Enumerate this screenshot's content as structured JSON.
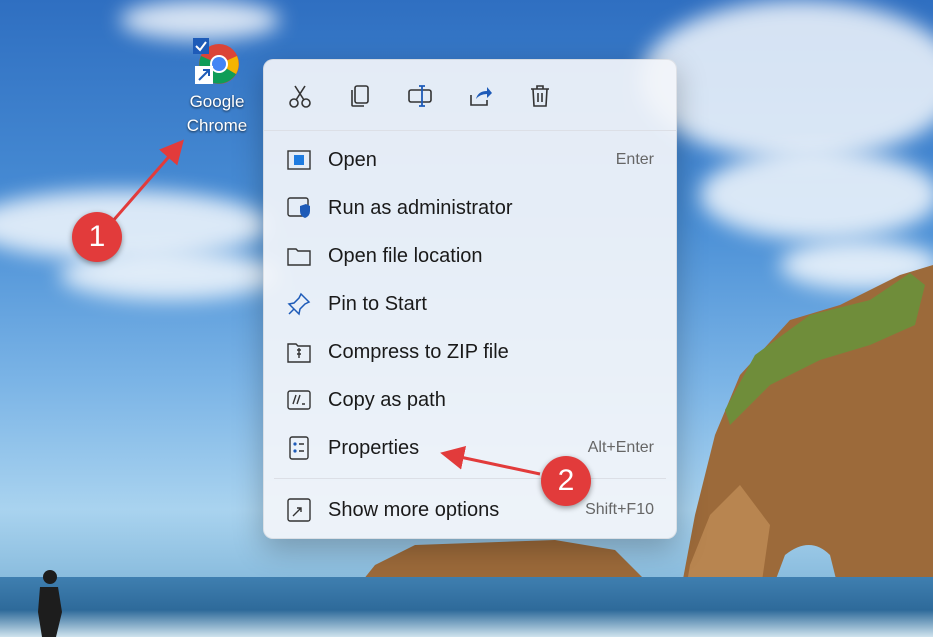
{
  "desktop": {
    "shortcut": {
      "label": "Google\nChrome",
      "icon": "chrome-icon"
    }
  },
  "context_menu": {
    "toolbar": [
      {
        "name": "cut-icon"
      },
      {
        "name": "copy-icon"
      },
      {
        "name": "rename-icon"
      },
      {
        "name": "share-icon"
      },
      {
        "name": "delete-icon"
      }
    ],
    "items": [
      {
        "label": "Open",
        "shortcut": "Enter",
        "icon": "open-icon"
      },
      {
        "label": "Run as administrator",
        "shortcut": "",
        "icon": "shield-icon"
      },
      {
        "label": "Open file location",
        "shortcut": "",
        "icon": "folder-icon"
      },
      {
        "label": "Pin to Start",
        "shortcut": "",
        "icon": "pin-icon"
      },
      {
        "label": "Compress to ZIP file",
        "shortcut": "",
        "icon": "zip-icon"
      },
      {
        "label": "Copy as path",
        "shortcut": "",
        "icon": "path-icon"
      },
      {
        "label": "Properties",
        "shortcut": "Alt+Enter",
        "icon": "properties-icon"
      }
    ],
    "more": {
      "label": "Show more options",
      "shortcut": "Shift+F10",
      "icon": "more-options-icon"
    }
  },
  "annotations": {
    "badge1": "1",
    "badge2": "2",
    "color": "#e23b3b"
  }
}
